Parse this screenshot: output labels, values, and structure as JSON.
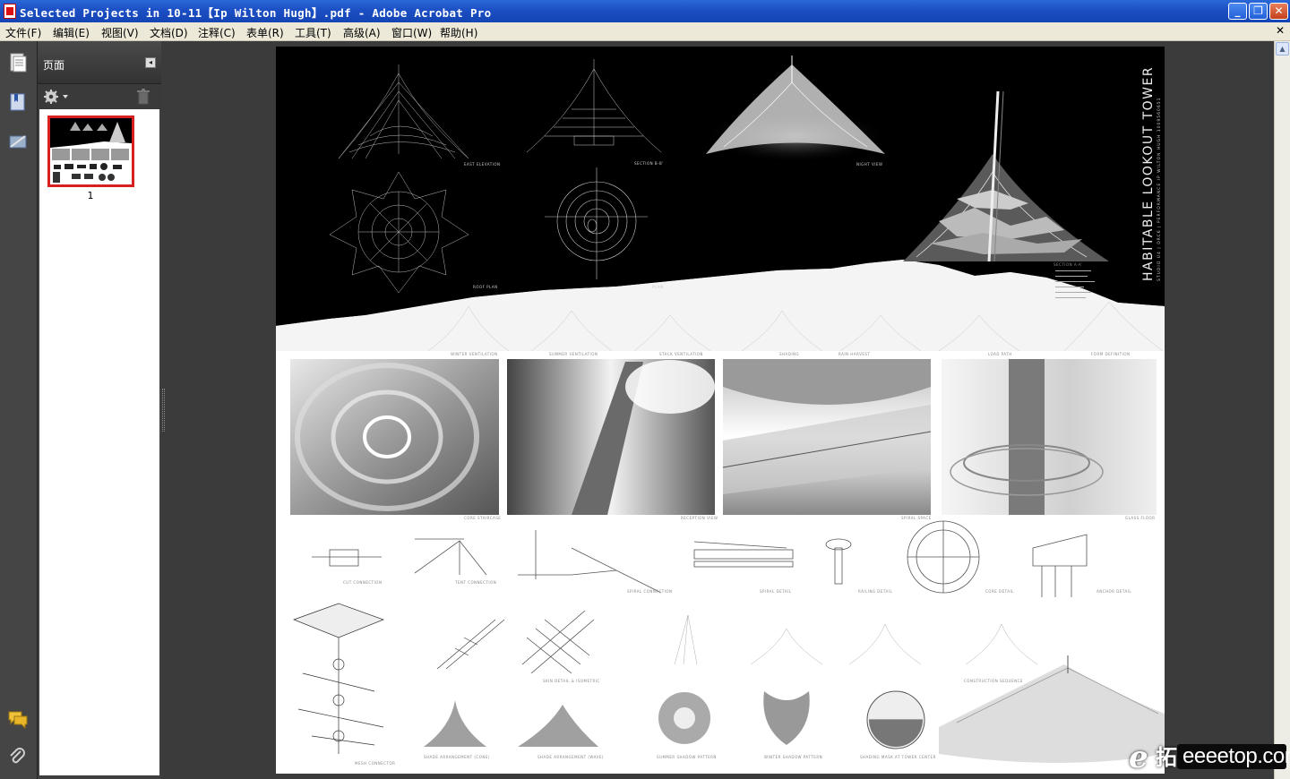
{
  "window": {
    "title": "Selected Projects in 10-11【Ip Wilton Hugh】.pdf - Adobe Acrobat Pro",
    "minimize": "_",
    "restore": "❐",
    "close": "✕"
  },
  "menu": {
    "items": [
      "文件(F)",
      "编辑(E)",
      "视图(V)",
      "文档(D)",
      "注释(C)",
      "表单(R)",
      "工具(T)",
      "高级(A)",
      "窗口(W)",
      "帮助(H)"
    ],
    "close": "✕"
  },
  "panel": {
    "title": "页面",
    "collapse": "◂",
    "thumbnail_label": "1"
  },
  "nav_icons": [
    "page-thumbnails-icon",
    "bookmarks-icon",
    "signatures-icon",
    "comments-icon",
    "attachments-icon"
  ],
  "document": {
    "header_text": "HABITABLE LOOKOUT TOWER",
    "header_sub": "STUDIO U4 | DRC6 | PERFORMANCE   IP WILTON HUGH   1009560651",
    "labels": {
      "east_elevation": "EAST ELEVATION",
      "section_bb": "SECTION B-B'",
      "night_view": "NIGHT VIEW",
      "roof_plan": "ROOF PLAN",
      "plan": "PLAN",
      "section_aa": "SECTION A-A'",
      "winter_ventilation": "WINTER VENTILATION",
      "summer_ventilation": "SUMMER VENTILATION",
      "stack_ventilation": "STACK VENTILATION",
      "shading": "SHADING",
      "rain_harvest": "RAIN HARVEST",
      "load_path": "LOAD PATH",
      "form_definition": "FORM DEFINITION",
      "core_staircase": "CORE STAIRCASE",
      "reception_view": "RECEPTION VIEW",
      "spiral_space": "SPIRAL SPACE",
      "glass_floor": "GLASS FLOOR",
      "cut_connection": "CUT CONNECTION",
      "tent_connection": "TENT CONNECTION",
      "spiral_connection": "SPIRAL CONNECTION",
      "spiral_detail": "SPIRAL DETAIL",
      "railing_detail": "RAILING DETAIL",
      "core_detail": "CORE DETAIL",
      "anchor_detail": "ANCHOR DETAIL",
      "mesh_connector": "MESH CONNECTOR",
      "skin_detail": "SKIN DETAIL & ISOMETRIC",
      "construction_sequence": "CONSTRUCTION SEQUENCE",
      "shade_cone": "SHADE ARRANGEMENT (CONE)",
      "shade_wave": "SHADE ARRANGEMENT (WAVE)",
      "summer_shadow": "SUMMER SHADOW PATTERN",
      "winter_shadow": "WINTER SHADOW PATTERN",
      "shading_mask": "SHADING MASK AT TOWER CENTER"
    }
  },
  "watermark": {
    "letter": "e",
    "chinese": "拓",
    "site": "eeeetop.com"
  },
  "colors": {
    "titlebar": "#1c4fc4",
    "menubar": "#ece9d8",
    "panel": "#3f3f3f",
    "thumbnail_border": "#d92020"
  }
}
